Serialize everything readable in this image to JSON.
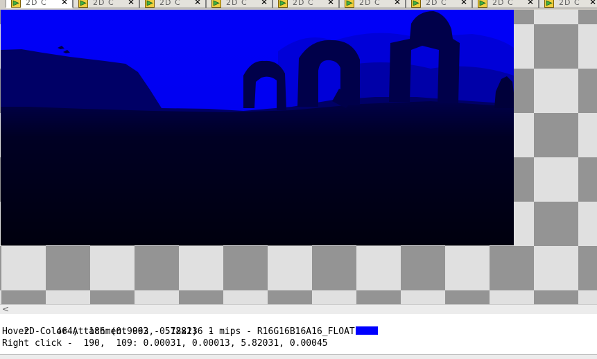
{
  "tabs": [
    {
      "label": "2D C",
      "close": "✕",
      "active": true
    },
    {
      "label": "2D C",
      "close": "✕",
      "active": false
    },
    {
      "label": "2D C",
      "close": "✕",
      "active": false
    },
    {
      "label": "2D C",
      "close": "✕",
      "active": false
    },
    {
      "label": "2D C",
      "close": "✕",
      "active": false
    },
    {
      "label": "2D C",
      "close": "✕",
      "active": false
    },
    {
      "label": "2D C",
      "close": "✕",
      "active": false
    },
    {
      "label": "2D C",
      "close": "✕",
      "active": false
    },
    {
      "label": "2D C",
      "close": "✕",
      "active": false
    }
  ],
  "scroll": {
    "left_arrow": "<"
  },
  "status": {
    "info": "2D Color Attachment 992 - 512x236 1 mips - R16G16B16A16_FLOAT",
    "hover": "Hover -   464,  186 (0.9063, 0.7881)  -",
    "right_click": "Right click -  190,  109: 0.00031, 0.00013, 5.82031, 0.00045",
    "swatch_color": "#0000ff"
  },
  "colors": {
    "sky": "#0000ff",
    "ground": "#00001c",
    "checker_dark": "#949494",
    "checker_light": "#e0e0e0",
    "tab_icon_yellow": "#f0d040",
    "tab_icon_green": "#40b040"
  }
}
